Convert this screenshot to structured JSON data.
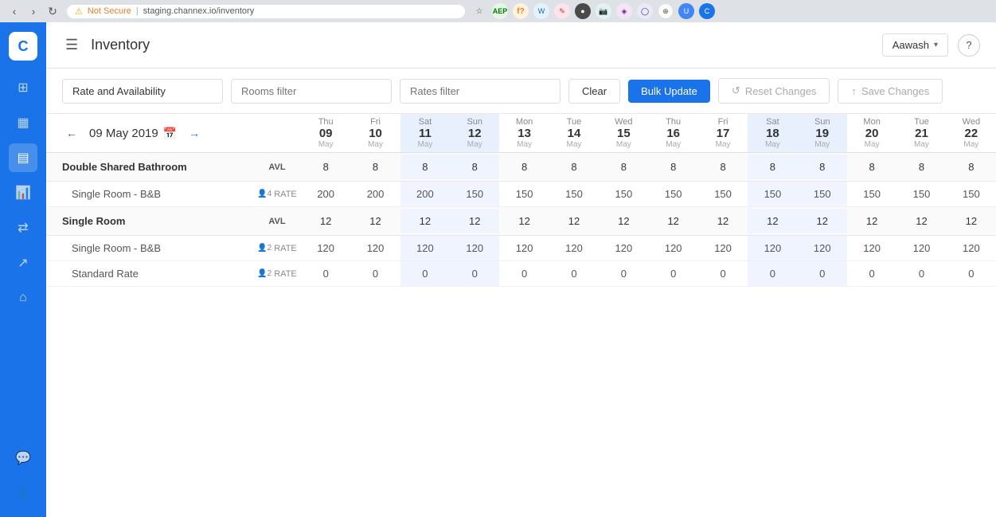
{
  "browser": {
    "url": "staging.channex.io/inventory",
    "not_secure_label": "Not Secure"
  },
  "header": {
    "title": "Inventory",
    "hamburger_icon": "☰",
    "property_selector": "Aawash",
    "help_label": "?"
  },
  "toolbar": {
    "filter_rate_avail": "Rate and Availability",
    "filter_rooms_placeholder": "Rooms filter",
    "filter_rates_placeholder": "Rates filter",
    "clear_label": "Clear",
    "bulk_update_label": "Bulk Update",
    "reset_label": "Reset Changes",
    "save_label": "Save Changes",
    "reset_icon": "↺",
    "save_icon": "↑"
  },
  "calendar": {
    "current_date": "09 May 2019",
    "calendar_icon": "📅",
    "prev_icon": "←",
    "next_icon": "→"
  },
  "date_columns": [
    {
      "day": "Thu",
      "num": "09",
      "month": "May",
      "weekend": false
    },
    {
      "day": "Fri",
      "num": "10",
      "month": "May",
      "weekend": false
    },
    {
      "day": "Sat",
      "num": "11",
      "month": "May",
      "weekend": true
    },
    {
      "day": "Sun",
      "num": "12",
      "month": "May",
      "weekend": true
    },
    {
      "day": "Mon",
      "num": "13",
      "month": "May",
      "weekend": false
    },
    {
      "day": "Tue",
      "num": "14",
      "month": "May",
      "weekend": false
    },
    {
      "day": "Wed",
      "num": "15",
      "month": "May",
      "weekend": false
    },
    {
      "day": "Thu",
      "num": "16",
      "month": "May",
      "weekend": false
    },
    {
      "day": "Fri",
      "num": "17",
      "month": "May",
      "weekend": false
    },
    {
      "day": "Sat",
      "num": "18",
      "month": "May",
      "weekend": true
    },
    {
      "day": "Sun",
      "num": "19",
      "month": "May",
      "weekend": true
    },
    {
      "day": "Mon",
      "num": "20",
      "month": "May",
      "weekend": false
    },
    {
      "day": "Tue",
      "num": "21",
      "month": "May",
      "weekend": false
    },
    {
      "day": "Wed",
      "num": "22",
      "month": "May",
      "weekend": false
    }
  ],
  "inventory_groups": [
    {
      "name": "Double Shared Bathroom",
      "type": "AVL",
      "avl_values": [
        8,
        8,
        8,
        8,
        8,
        8,
        8,
        8,
        8,
        8,
        8,
        8,
        8,
        8
      ],
      "rates": [
        {
          "name": "Single Room - B&B",
          "guests": 4,
          "type": "RATE",
          "values": [
            200,
            200,
            200,
            150,
            150,
            150,
            150,
            150,
            150,
            150,
            150,
            150,
            150,
            150
          ]
        }
      ]
    },
    {
      "name": "Single Room",
      "type": "AVL",
      "avl_values": [
        12,
        12,
        12,
        12,
        12,
        12,
        12,
        12,
        12,
        12,
        12,
        12,
        12,
        12
      ],
      "rates": [
        {
          "name": "Single Room - B&B",
          "guests": 2,
          "type": "RATE",
          "values": [
            120,
            120,
            120,
            120,
            120,
            120,
            120,
            120,
            120,
            120,
            120,
            120,
            120,
            120
          ]
        },
        {
          "name": "Standard Rate",
          "guests": 2,
          "type": "RATE",
          "values": [
            0,
            0,
            0,
            0,
            0,
            0,
            0,
            0,
            0,
            0,
            0,
            0,
            0,
            0
          ]
        }
      ]
    }
  ],
  "sidebar_icons": [
    {
      "name": "dashboard",
      "symbol": "⊞",
      "active": false
    },
    {
      "name": "calendar",
      "symbol": "📅",
      "active": false
    },
    {
      "name": "inventory",
      "symbol": "▤",
      "active": true
    },
    {
      "name": "reports",
      "symbol": "📊",
      "active": false
    },
    {
      "name": "channels",
      "symbol": "⇄",
      "active": false
    },
    {
      "name": "share",
      "symbol": "↗",
      "active": false
    },
    {
      "name": "home",
      "symbol": "⌂",
      "active": false
    },
    {
      "name": "messages",
      "symbol": "💬",
      "active": false
    },
    {
      "name": "account",
      "symbol": "👤",
      "active": false
    }
  ],
  "colors": {
    "sidebar_bg": "#1a73e8",
    "weekend_bg": "#e8f0fe",
    "weekend_avl_bg": "#d4e3fc",
    "accent": "#1a73e8"
  }
}
